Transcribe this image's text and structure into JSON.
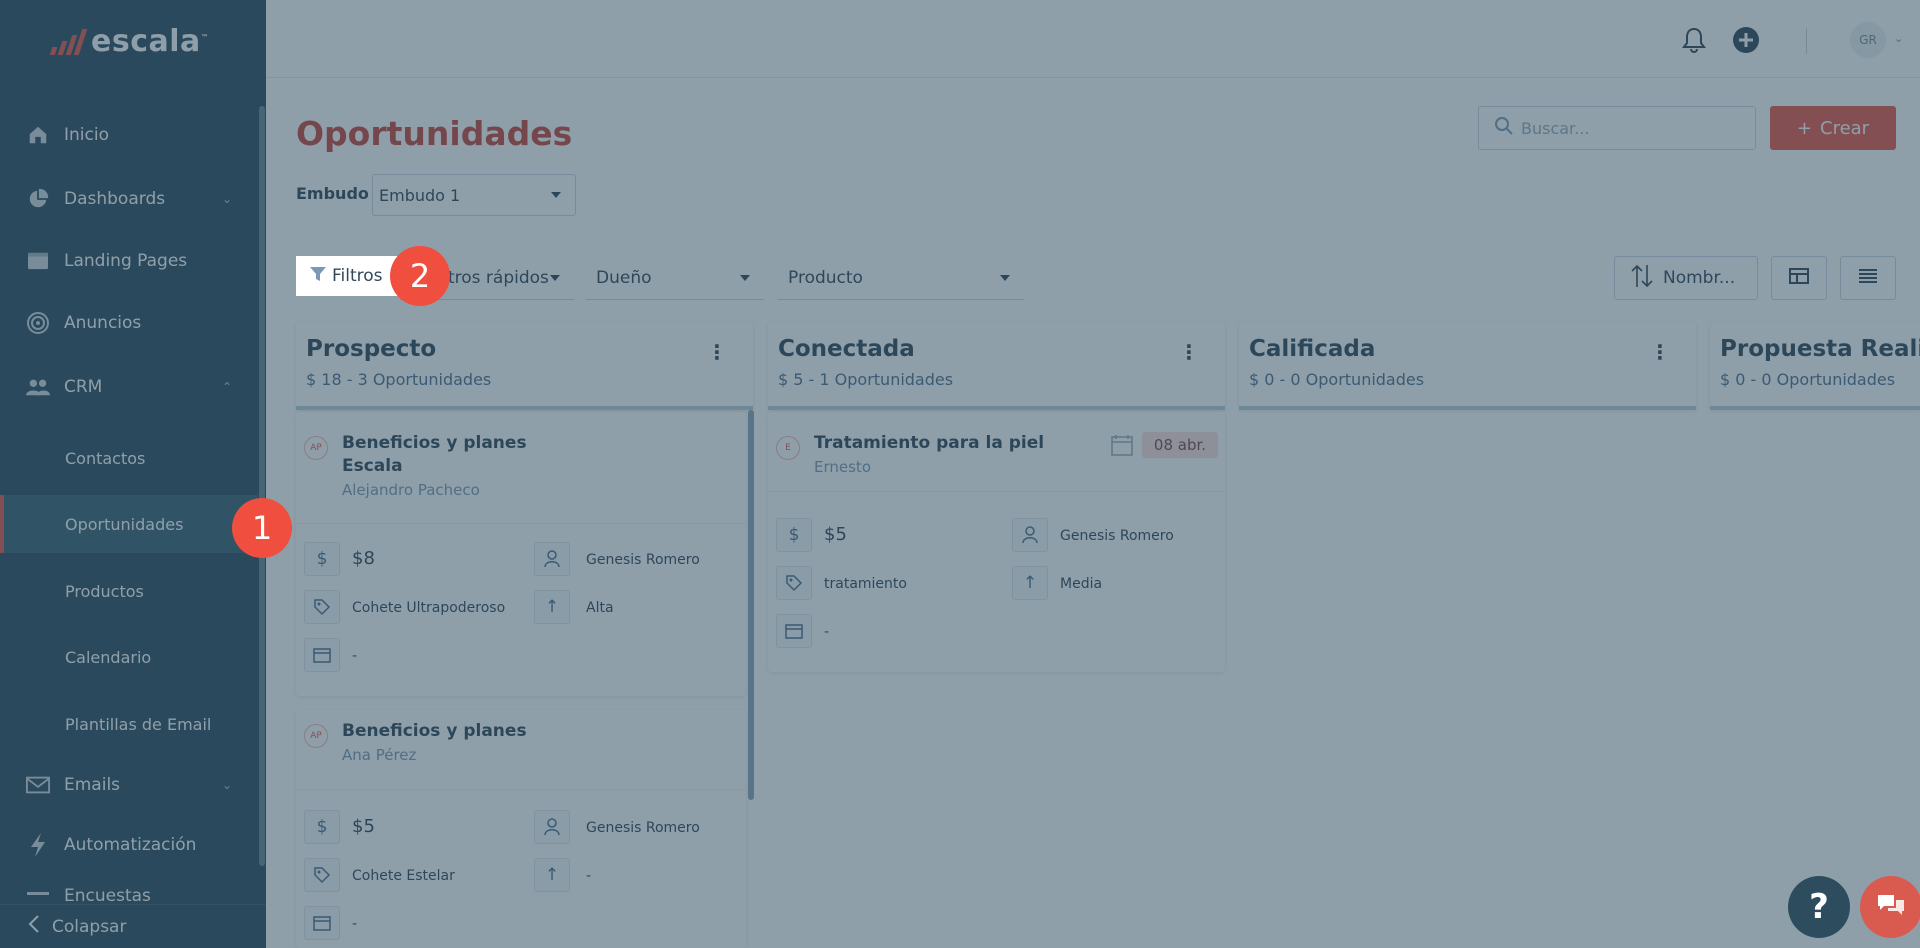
{
  "app": {
    "logo_text": "escala",
    "logo_tm": "™",
    "brand_color": "#e8584c"
  },
  "sidebar": {
    "items": [
      {
        "label": "Inicio",
        "icon": "home-icon"
      },
      {
        "label": "Dashboards",
        "icon": "pie-chart-icon"
      },
      {
        "label": "Landing Pages",
        "icon": "browser-icon"
      },
      {
        "label": "Anuncios",
        "icon": "target-icon"
      },
      {
        "label": "CRM",
        "icon": "users-icon"
      },
      {
        "label": "Emails",
        "icon": "mail-icon"
      },
      {
        "label": "Automatización",
        "icon": "lightning-icon"
      },
      {
        "label": "Encuestas",
        "icon": "list-icon"
      }
    ],
    "crm_subitems": [
      "Contactos",
      "Oportunidades",
      "Productos",
      "Calendario",
      "Plantillas de Email"
    ],
    "active_subitem": "Oportunidades",
    "collapse_label": "Colapsar"
  },
  "header": {
    "avatar_initials": "GR"
  },
  "page": {
    "title": "Oportunidades",
    "search_placeholder": "Buscar...",
    "create_label": "Crear",
    "embudo_label": "Embudo",
    "embudo_value": "Embudo 1",
    "filters_label": "Filtros",
    "quick_filters_label": "Filtros rápidos",
    "owner_label": "Dueño",
    "product_label": "Producto",
    "sort_label": "Nombr..."
  },
  "columns": [
    {
      "title": "Prospecto",
      "summary": "$ 18 - 3 Oportunidades"
    },
    {
      "title": "Conectada",
      "summary": "$ 5 - 1 Oportunidades"
    },
    {
      "title": "Calificada",
      "summary": "$ 0 - 0 Oportunidades"
    },
    {
      "title": "Propuesta Reali",
      "summary": "$ 0 - 0 Oportunidades"
    }
  ],
  "cards": [
    {
      "initials": "AP",
      "title_line1": "Beneficios y planes",
      "title_line2": "Escala",
      "person": "Alejandro Pacheco",
      "amount": "$8",
      "owner": "Genesis Romero",
      "product": "Cohete Ultrapoderoso",
      "priority": "Alta",
      "date": "-"
    },
    {
      "initials": "AP",
      "title_line1": "Beneficios y planes",
      "person": "Ana Pérez",
      "amount": "$5",
      "owner": "Genesis Romero",
      "product": "Cohete Estelar",
      "priority": "-",
      "date": "-"
    },
    {
      "initials": "E",
      "title_line1": "Tratamiento para la piel",
      "person": "Ernesto",
      "badge": "08 abr.",
      "amount": "$5",
      "owner": "Genesis Romero",
      "product": "tratamiento",
      "priority": "Media",
      "date": "-"
    }
  ],
  "steps": [
    "1",
    "2"
  ],
  "help_label": "?"
}
